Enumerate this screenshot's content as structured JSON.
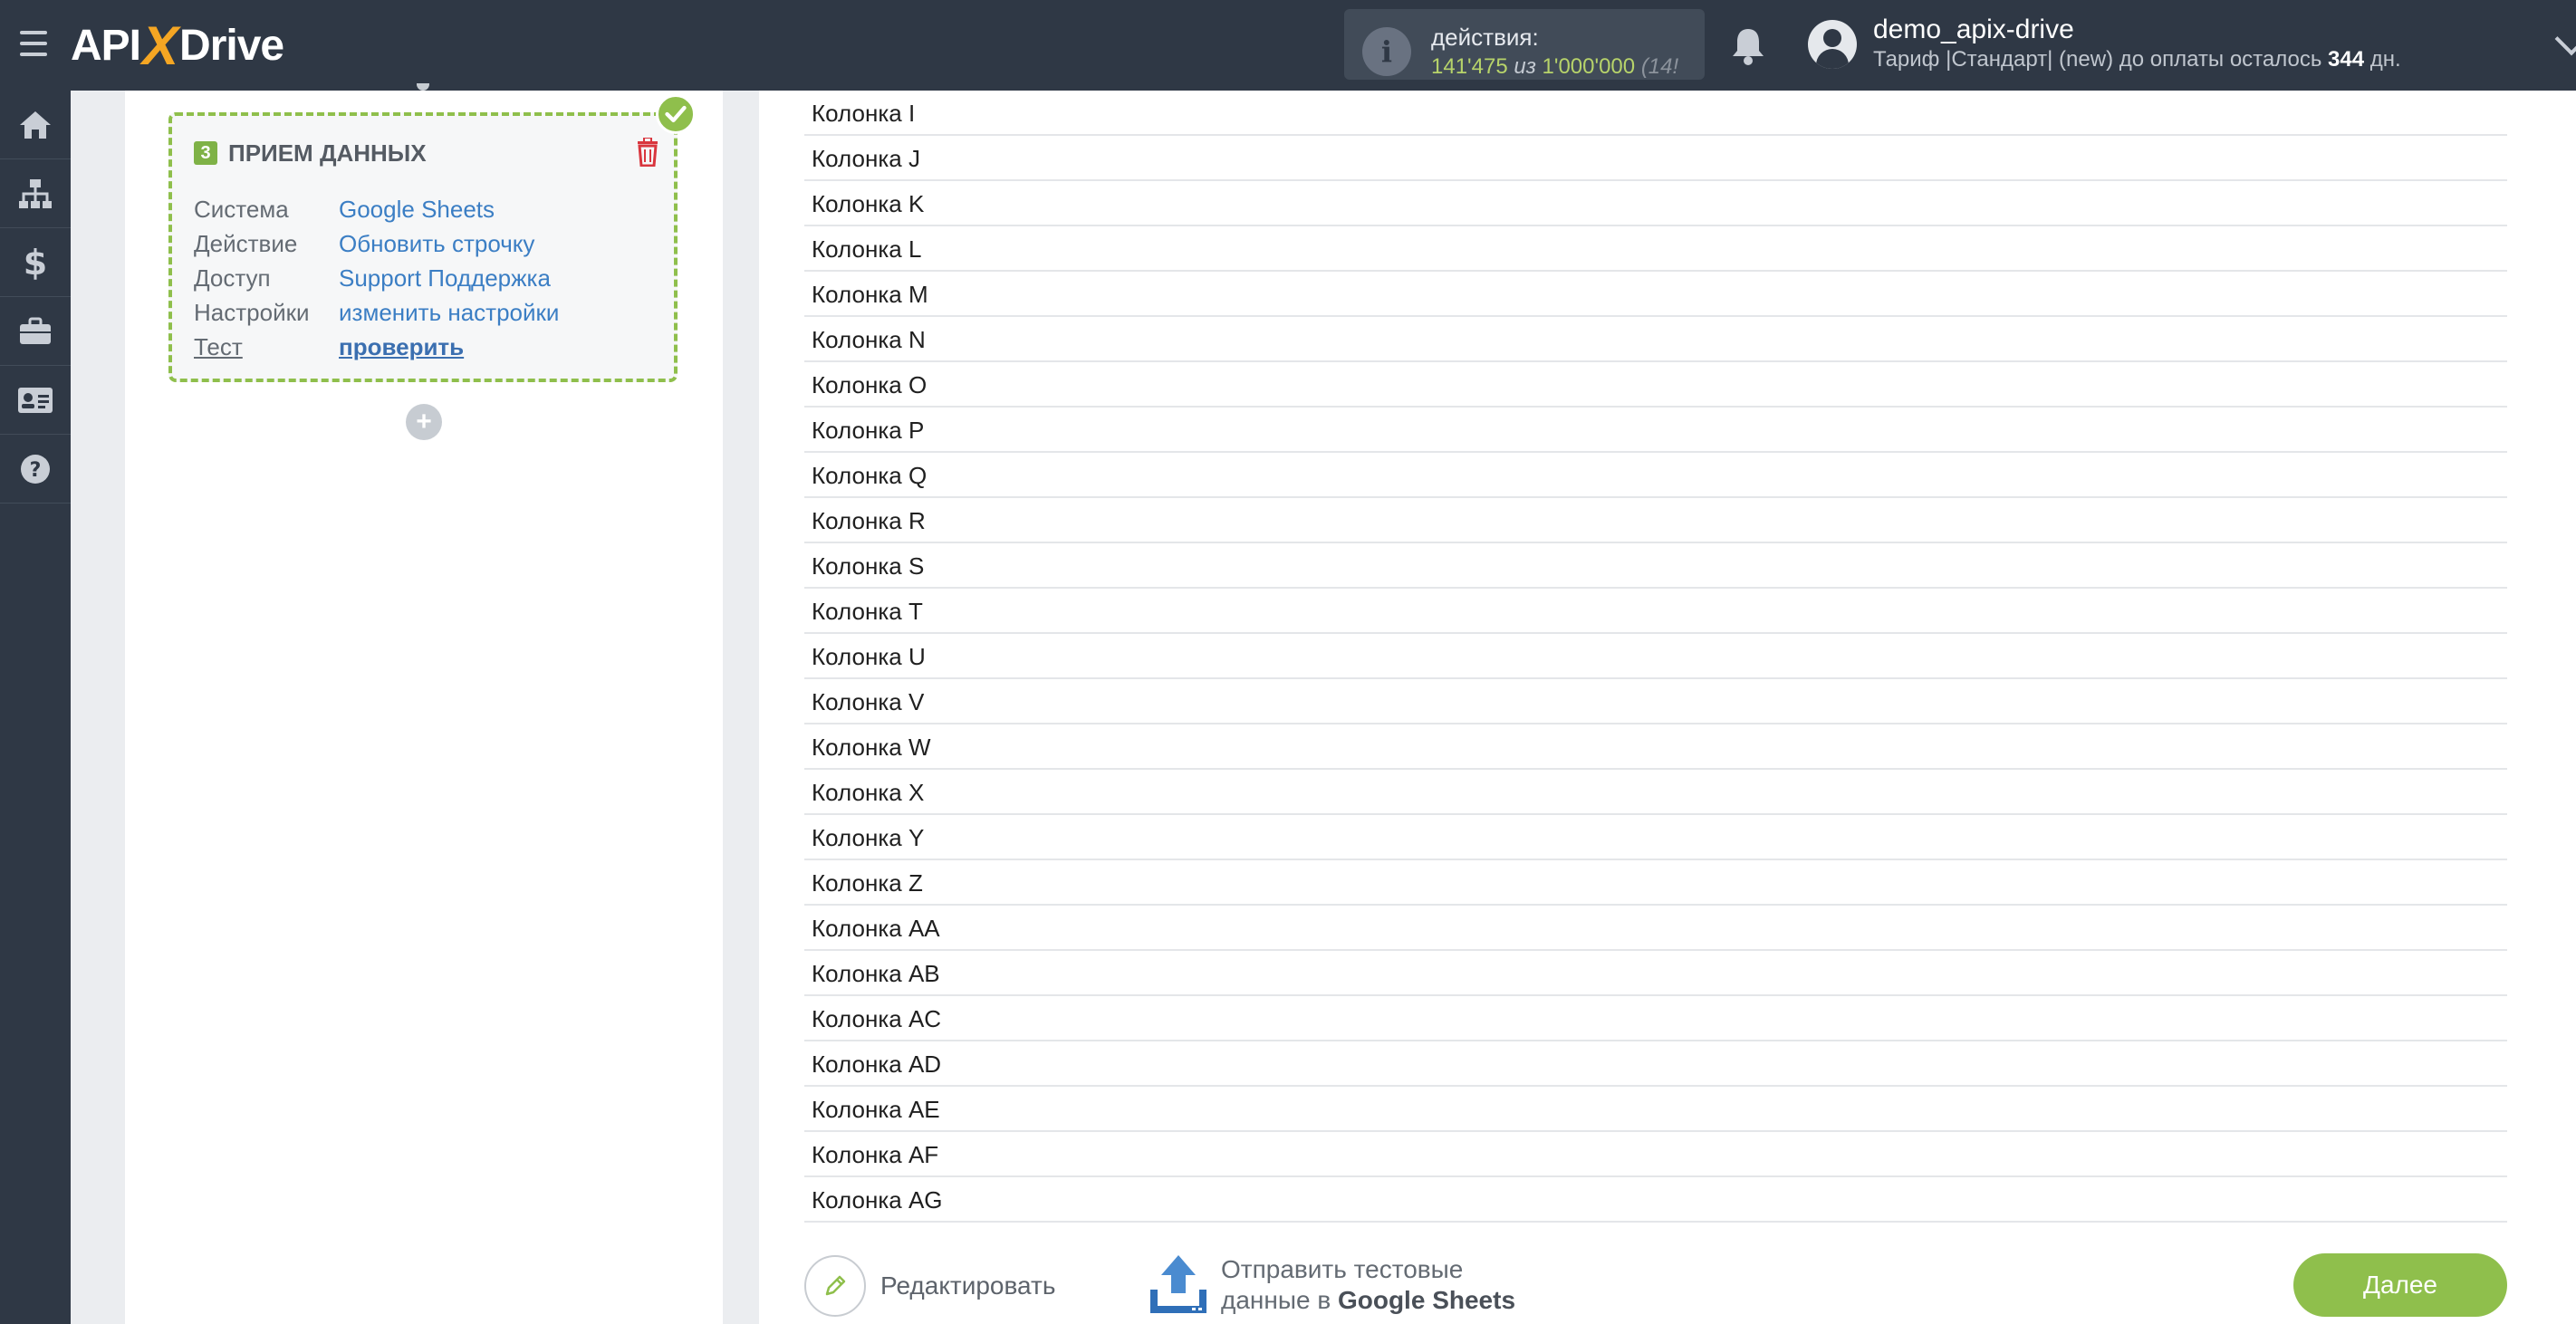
{
  "header": {
    "logo_left": "API",
    "logo_x": "X",
    "logo_right": "Drive",
    "actions_label": "действия:",
    "actions_used": "141'475",
    "actions_of": "из",
    "actions_total": "1'000'000",
    "actions_extra": "(14!",
    "username": "demo_apix-drive",
    "plan_prefix": "Тариф |Стандарт| (new) до оплаты осталось",
    "plan_days": "344",
    "plan_suffix": "дн."
  },
  "sidebar": {
    "items": [
      "home-icon",
      "sitemap-icon",
      "dollar-icon",
      "briefcase-icon",
      "id-card-icon",
      "help-icon"
    ]
  },
  "card": {
    "step": "3",
    "title": "ПРИЕМ ДАННЫХ",
    "rows": [
      {
        "label": "Система",
        "value": "Google Sheets"
      },
      {
        "label": "Действие",
        "value": "Обновить строчку"
      },
      {
        "label": "Доступ",
        "value": "Support Поддержка"
      },
      {
        "label": "Настройки",
        "value": "изменить настройки"
      },
      {
        "label": "Тест",
        "value": "проверить"
      }
    ],
    "add_label": "+"
  },
  "columns": [
    "Колонка I",
    "Колонка J",
    "Колонка K",
    "Колонка L",
    "Колонка M",
    "Колонка N",
    "Колонка O",
    "Колонка P",
    "Колонка Q",
    "Колонка R",
    "Колонка S",
    "Колонка T",
    "Колонка U",
    "Колонка V",
    "Колонка W",
    "Колонка X",
    "Колонка Y",
    "Колонка Z",
    "Колонка AA",
    "Колонка AB",
    "Колонка AC",
    "Колонка AD",
    "Колонка AE",
    "Колонка AF",
    "Колонка AG"
  ],
  "footer": {
    "edit_label": "Редактировать",
    "send_line1": "Отправить тестовые",
    "send_line2_prefix": "данные в",
    "send_line2_target": "Google Sheets",
    "next_label": "Далее"
  },
  "colors": {
    "topbar": "#2f3845",
    "accent_green": "#8fbf4c",
    "link_blue": "#3b7ec4"
  }
}
